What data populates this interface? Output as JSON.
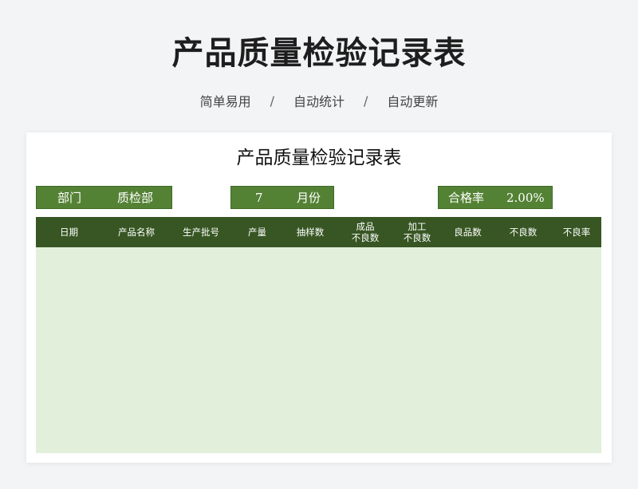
{
  "header": {
    "title": "产品质量检验记录表",
    "taglines": [
      "简单易用",
      "自动统计",
      "自动更新"
    ],
    "separator": "/"
  },
  "sheet": {
    "title": "产品质量检验记录表",
    "dept_label": "部门",
    "dept_value": "质检部",
    "month_value": "7",
    "month_label": "月份",
    "rate_label": "合格率",
    "rate_value": "2.00%"
  },
  "table": {
    "columns": [
      {
        "line1": "日期",
        "line2": ""
      },
      {
        "line1": "产品名称",
        "line2": ""
      },
      {
        "line1": "生产批号",
        "line2": ""
      },
      {
        "line1": "产量",
        "line2": ""
      },
      {
        "line1": "抽样数",
        "line2": ""
      },
      {
        "line1": "成品",
        "line2": "不良数"
      },
      {
        "line1": "加工",
        "line2": "不良数"
      },
      {
        "line1": "良品数",
        "line2": ""
      },
      {
        "line1": "不良数",
        "line2": ""
      },
      {
        "line1": "不良率",
        "line2": ""
      }
    ],
    "rows": []
  },
  "colors": {
    "header_green": "#375623",
    "box_green": "#548235",
    "body_green": "#e2efda"
  }
}
